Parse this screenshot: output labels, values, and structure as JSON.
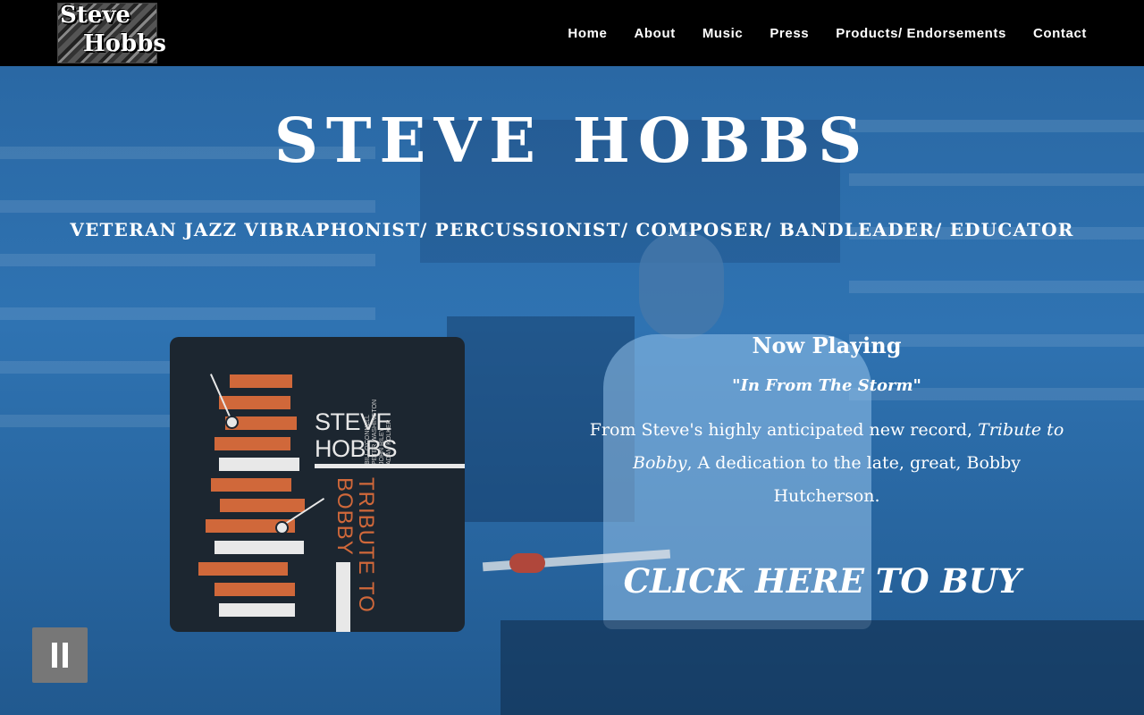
{
  "logo": {
    "line1": "Steve",
    "line2": "Hobbs"
  },
  "nav": {
    "items": [
      {
        "label": "Home"
      },
      {
        "label": "About"
      },
      {
        "label": "Music"
      },
      {
        "label": "Press"
      },
      {
        "label": "Products/ Endorsements"
      },
      {
        "label": "Contact"
      }
    ]
  },
  "hero": {
    "title": "STEVE HOBBS",
    "subtitle": "VETERAN JAZZ VIBRAPHONIST/ PERCUSSIONIST/ COMPOSER/ BANDLEADER/ EDUCATOR"
  },
  "album": {
    "artist_line1": "STEVE",
    "artist_line2": "HOBBS",
    "credits": "BILL O'CONNELL\nPETER WASHINGTON\nJOHN RILEY\nADAM KOLKER",
    "title": "TRIBUTE TO BOBBY"
  },
  "player": {
    "now_playing": "Now Playing",
    "song": "\"In From The Storm\"",
    "desc_prefix": "From Steve's highly anticipated new record, ",
    "desc_record": "Tribute to Bobby",
    "desc_suffix": ", A dedication to the late, great, Bobby Hutcherson.",
    "buy_label": "CLICK HERE TO BUY"
  },
  "video_control": {
    "icon": "pause-icon"
  }
}
